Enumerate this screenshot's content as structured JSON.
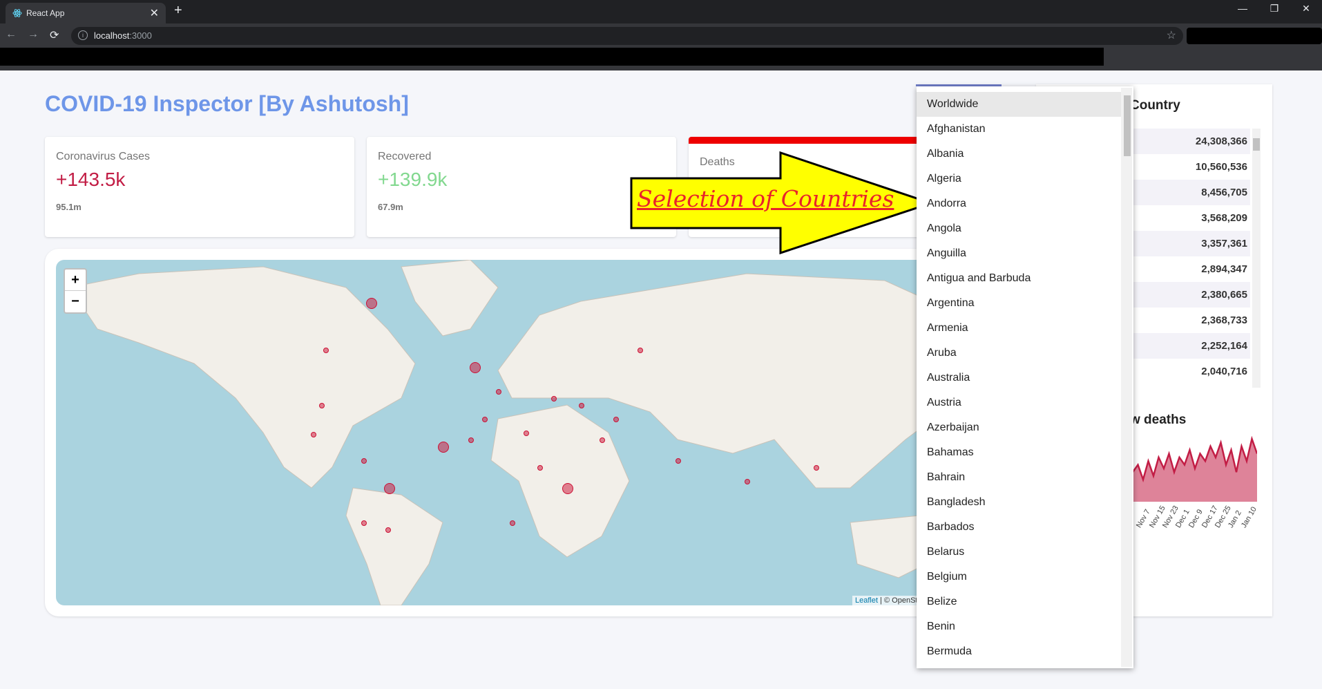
{
  "browser": {
    "tab_title": "React App",
    "new_tab": "+",
    "tab_close": "✕",
    "url_host": "localhost",
    "url_port": ":3000",
    "nav": {
      "back": "←",
      "forward": "→",
      "reload": "⟳"
    },
    "window": {
      "minimize": "—",
      "restore": "❐",
      "close": "✕"
    }
  },
  "app": {
    "title": "COVID-19 Inspector [By Ashutosh]",
    "cards": [
      {
        "title": "Coronavirus Cases",
        "value": "+143.5k",
        "total": "95.1m",
        "color": "#c21d45"
      },
      {
        "title": "Recovered",
        "value": "+139.9k",
        "total": "67.9m",
        "color": "#82d88f"
      },
      {
        "title": "Deaths",
        "value": "",
        "total": ""
      }
    ],
    "map": {
      "zoom_in": "+",
      "zoom_out": "−",
      "attribution_link": "Leaflet",
      "attribution_text": " | © OpenSt"
    },
    "right_panel": {
      "title_fragment": "Country",
      "values": [
        "24,308,366",
        "10,560,536",
        "8,456,705",
        "3,568,209",
        "3,357,361",
        "2,894,347",
        "2,380,665",
        "2,368,733",
        "2,252,164",
        "2,040,716"
      ],
      "chart_title_fragment": "w deaths"
    }
  },
  "dropdown": {
    "selected": "Worldwide",
    "options": [
      "Worldwide",
      "Afghanistan",
      "Albania",
      "Algeria",
      "Andorra",
      "Angola",
      "Anguilla",
      "Antigua and Barbuda",
      "Argentina",
      "Armenia",
      "Aruba",
      "Australia",
      "Austria",
      "Azerbaijan",
      "Bahamas",
      "Bahrain",
      "Bangladesh",
      "Barbados",
      "Belarus",
      "Belgium",
      "Belize",
      "Benin",
      "Bermuda"
    ]
  },
  "annotation": {
    "text": "Selection of Countries",
    "arrow_fill": "#ffff00"
  },
  "chart_data": {
    "type": "area",
    "title": "",
    "categories": [
      "Nov 7",
      "Nov 15",
      "Nov 23",
      "Dec 1",
      "Dec 9",
      "Dec 17",
      "Dec 25",
      "Jan 2",
      "Jan 10"
    ],
    "series": [
      {
        "values": [
          8,
          10,
          6,
          11,
          7,
          12,
          9,
          13,
          8,
          12,
          10,
          14,
          9,
          13,
          11,
          15,
          12,
          16,
          10,
          14,
          8,
          15,
          11,
          17,
          13
        ]
      }
    ],
    "color": "#c21d45"
  }
}
